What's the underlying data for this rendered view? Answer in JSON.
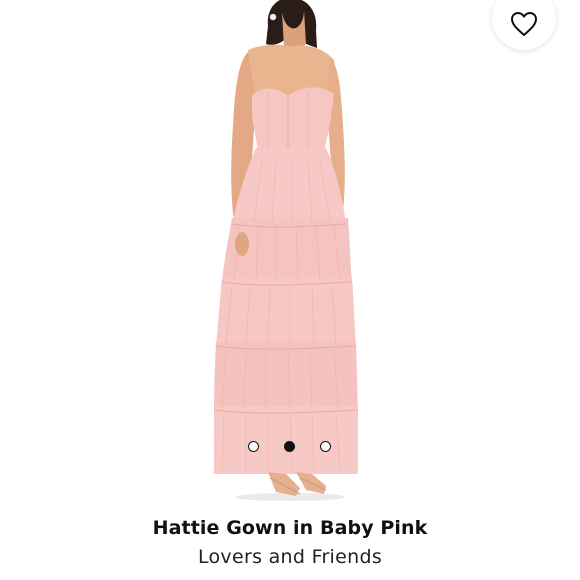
{
  "product": {
    "title": "Hattie Gown in Baby Pink",
    "brand": "Lovers and Friends"
  },
  "favorite": {
    "icon": "heart-outline-icon",
    "active": false
  },
  "carousel": {
    "total_slides": 3,
    "active_index": 1
  },
  "colors": {
    "dress": "#f7c9c6",
    "skin": "#e9b58f",
    "accent": "#111111"
  }
}
